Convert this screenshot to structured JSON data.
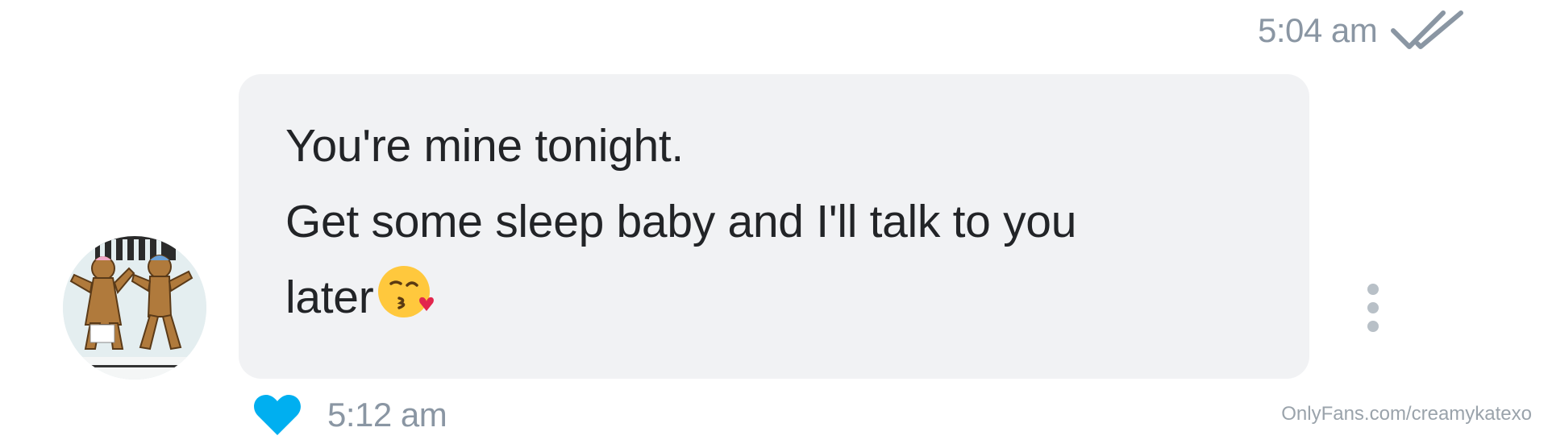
{
  "previous_message": {
    "time": "5:04 am",
    "status_icon": "double-check-icon"
  },
  "message": {
    "lines": [
      "You're mine tonight.",
      "Get some sleep baby and I'll talk to you",
      "later"
    ],
    "emoji": "face-blowing-a-kiss",
    "time": "5:12 am",
    "liked": true
  },
  "icons": {
    "like": "heart-icon",
    "more": "more-vertical-icon",
    "avatar": "gingerbread-avatar"
  },
  "colors": {
    "bubble": "#f1f2f4",
    "like": "#00aff0",
    "meta_text": "#8a96a3"
  },
  "watermark": "OnlyFans.com/creamykatexo"
}
